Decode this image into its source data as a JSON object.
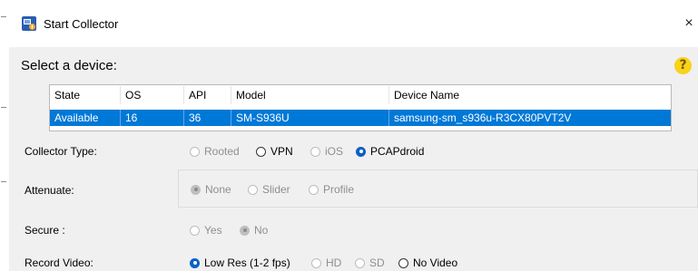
{
  "window": {
    "title": "Start Collector",
    "close_glyph": "×"
  },
  "select_device_label": "Select a device:",
  "help_glyph": "?",
  "device_table": {
    "columns": [
      "State",
      "OS",
      "API",
      "Model",
      "Device Name"
    ],
    "rows": [
      {
        "state": "Available",
        "os": "16",
        "api": "36",
        "model": "SM-S936U",
        "device_name": "samsung-sm_s936u-R3CX80PVT2V",
        "selected": true
      }
    ]
  },
  "collector_type": {
    "label": "Collector Type:",
    "options": [
      {
        "label": "Rooted",
        "checked": false,
        "enabled": false
      },
      {
        "label": "VPN",
        "checked": false,
        "enabled": true
      },
      {
        "label": "iOS",
        "checked": false,
        "enabled": false
      },
      {
        "label": "PCAPdroid",
        "checked": true,
        "enabled": true
      }
    ]
  },
  "attenuate": {
    "label": "Attenuate:",
    "options": [
      {
        "label": "None",
        "checked": true,
        "enabled": false
      },
      {
        "label": "Slider",
        "checked": false,
        "enabled": false
      },
      {
        "label": "Profile",
        "checked": false,
        "enabled": false
      }
    ]
  },
  "secure": {
    "label": "Secure :",
    "options": [
      {
        "label": "Yes",
        "checked": false,
        "enabled": false
      },
      {
        "label": "No",
        "checked": true,
        "enabled": false
      }
    ]
  },
  "record_video": {
    "label": "Record Video:",
    "options": [
      {
        "label": "Low Res (1-2 fps)",
        "checked": true,
        "enabled": true
      },
      {
        "label": "HD",
        "checked": false,
        "enabled": false
      },
      {
        "label": "SD",
        "checked": false,
        "enabled": false
      },
      {
        "label": "No Video",
        "checked": false,
        "enabled": true
      }
    ]
  },
  "colors": {
    "selection": "#0078d7",
    "radio_checked": "#0a5fc6",
    "help_icon": "#f7d31a",
    "background": "#f0f0f0"
  }
}
